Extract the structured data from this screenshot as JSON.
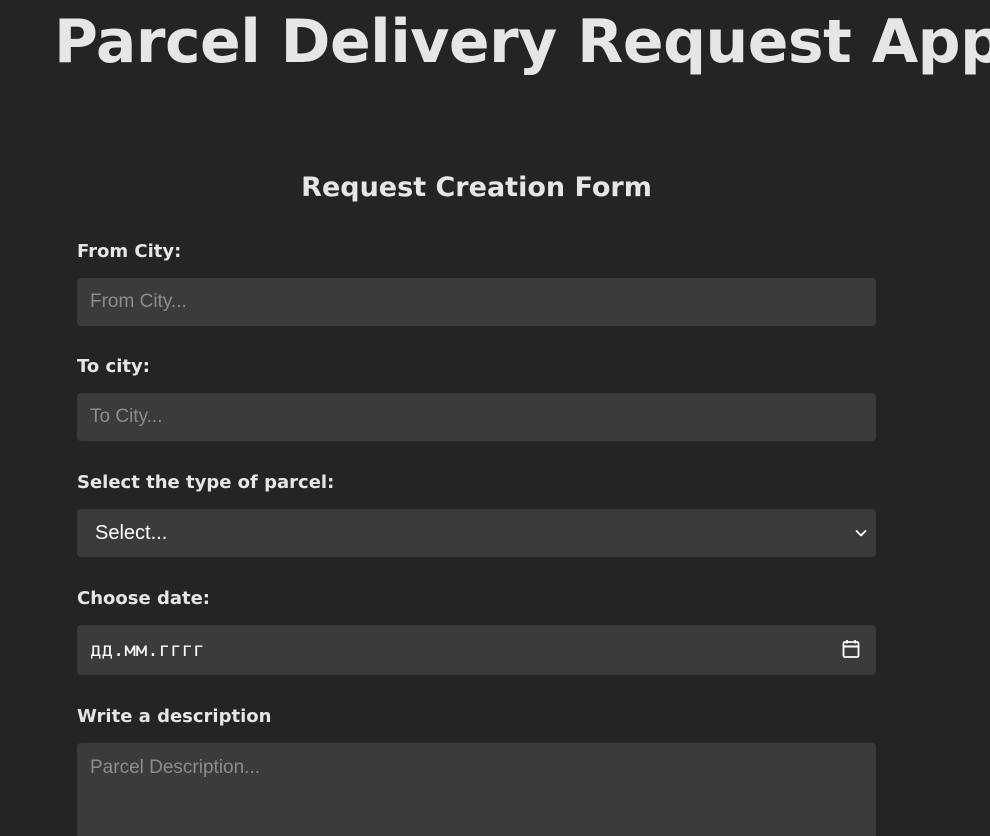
{
  "app": {
    "title": "Parcel Delivery Request App"
  },
  "form": {
    "title": "Request Creation Form",
    "from_city": {
      "label": "From City:",
      "value": "",
      "placeholder": "From City..."
    },
    "to_city": {
      "label": "To city:",
      "value": "",
      "placeholder": "To City..."
    },
    "parcel_type": {
      "label": "Select the type of parcel:",
      "selected": "Select..."
    },
    "date": {
      "label": "Choose date:",
      "display": "дд.мм.гггг"
    },
    "description": {
      "label": "Write a description",
      "value": "",
      "placeholder": "Parcel Description..."
    }
  },
  "icons": {
    "select_arrow": "chevron-down-icon",
    "date_picker": "calendar-icon"
  },
  "colors": {
    "background": "#242424",
    "field_background": "#3b3b3b",
    "text": "#e6e6e6",
    "placeholder": "#8c8c8c"
  }
}
